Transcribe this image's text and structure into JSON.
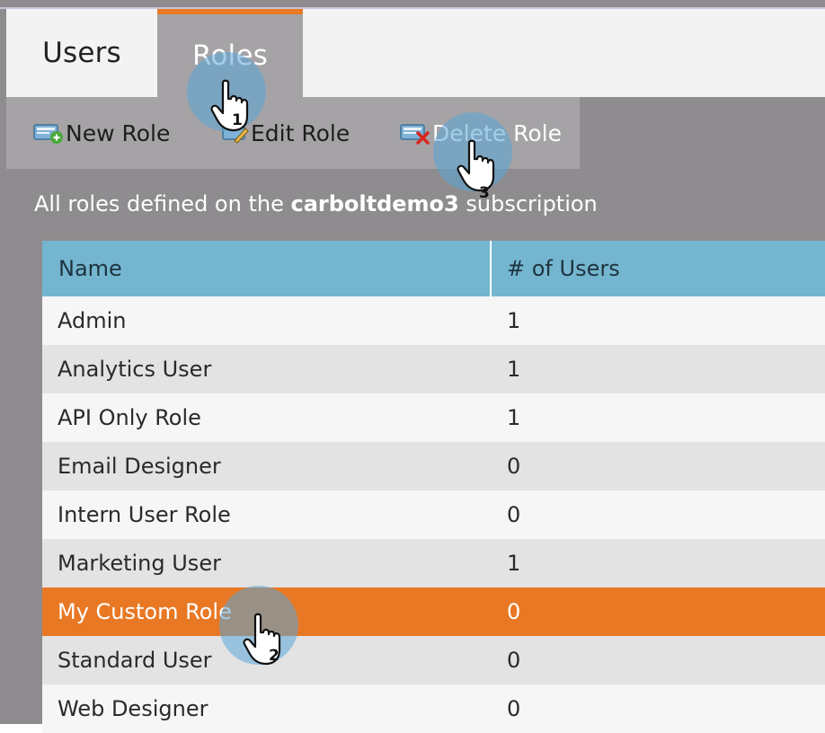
{
  "tabs": {
    "users_label": "Users",
    "roles_label": "Roles"
  },
  "toolbar": {
    "new_role_label": "New Role",
    "edit_role_label": "Edit Role",
    "delete_role_label": "Delete Role"
  },
  "description": {
    "prefix": "All roles defined on the ",
    "subscription": "carboltdemo3",
    "suffix": " subscription"
  },
  "grid": {
    "columns": [
      "Name",
      "# of Users"
    ],
    "rows": [
      {
        "name": "Admin",
        "users": "1"
      },
      {
        "name": "Analytics User",
        "users": "1"
      },
      {
        "name": "API Only Role",
        "users": "1"
      },
      {
        "name": "Email Designer",
        "users": "0"
      },
      {
        "name": "Intern User Role",
        "users": "0"
      },
      {
        "name": "Marketing User",
        "users": "1"
      },
      {
        "name": "My Custom Role",
        "users": "0"
      },
      {
        "name": "Standard User",
        "users": "0"
      },
      {
        "name": "Web Designer",
        "users": "0"
      }
    ],
    "selected_row": "My Custom Role"
  },
  "steps": {
    "step1": "1",
    "step2": "2",
    "step3": "3"
  },
  "colors": {
    "accent": "#ea7a26",
    "header": "#74b6cf",
    "panel": "#8e8c8f",
    "halo": "#5aa5d7"
  },
  "icons": {
    "new_role": "role-add-icon",
    "edit_role": "role-edit-icon",
    "delete_role": "role-delete-icon",
    "pointer": "hand-pointer-icon"
  }
}
